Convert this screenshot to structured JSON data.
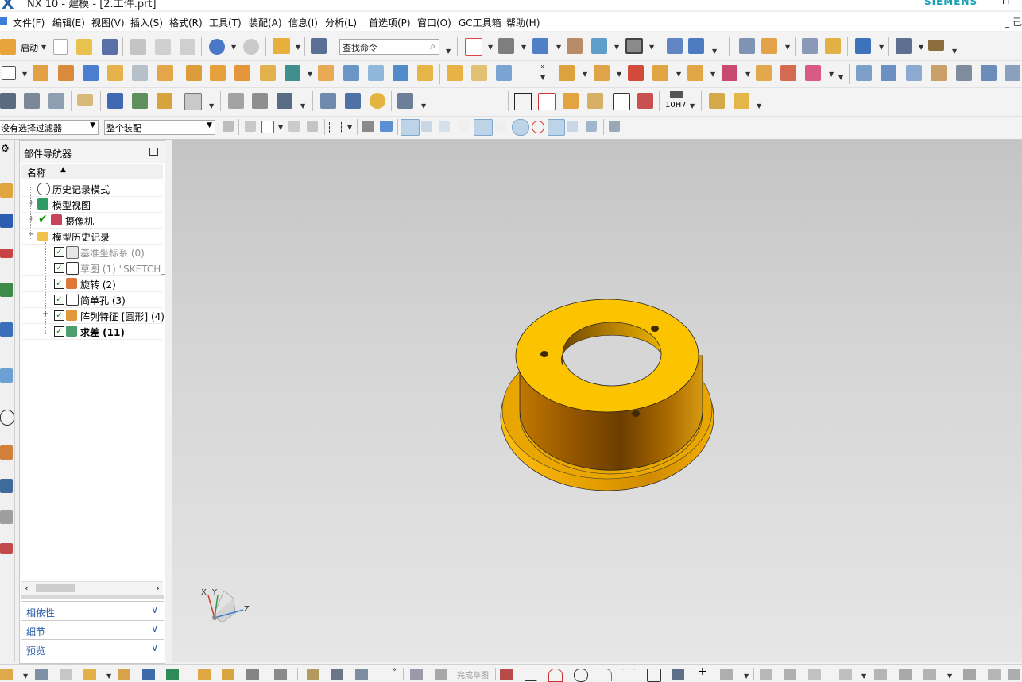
{
  "window": {
    "title": "NX 10 - 建模 - [2.工件.prt]",
    "brand": "SIEMENS",
    "controls": "_ ⊓"
  },
  "menu": {
    "items": [
      "文件(F)",
      "编辑(E)",
      "视图(V)",
      "插入(S)",
      "格式(R)",
      "工具(T)",
      "装配(A)",
      "信息(I)",
      "分析(L)",
      "首选项(P)",
      "窗口(O)",
      "GC工具箱",
      "帮助(H)"
    ],
    "right": "_ 己"
  },
  "toolbar": {
    "start_label": "启动",
    "search_placeholder": "查找命令",
    "selection_filter": "没有选择过滤器",
    "assembly_scope": "整个装配",
    "hole_tool_label": "10H7"
  },
  "navigator": {
    "title": "部件导航器",
    "column_name": "名称",
    "rows": [
      {
        "label": "历史记录模式",
        "icon": "clock-icon"
      },
      {
        "label": "模型视图",
        "icon": "model-views-icon"
      },
      {
        "label": "摄像机",
        "icon": "camera-icon"
      },
      {
        "label": "模型历史记录",
        "icon": "folder-icon"
      },
      {
        "label": "基准坐标系 (0)",
        "icon": "datum-csys-icon"
      },
      {
        "label": "草图 (1) \"SKETCH_",
        "icon": "sketch-icon"
      },
      {
        "label": "旋转 (2)",
        "icon": "revolve-icon"
      },
      {
        "label": "简单孔 (3)",
        "icon": "simple-hole-icon"
      },
      {
        "label": "阵列特征 [圆形] (4)",
        "icon": "pattern-feature-icon"
      },
      {
        "label": "求差 (11)",
        "icon": "subtract-icon"
      }
    ],
    "panels": [
      "相依性",
      "细节",
      "预览"
    ]
  },
  "viewport": {
    "part_color": "#f5c400",
    "triad": {
      "x": "X",
      "y": "Y",
      "z": "Z"
    }
  },
  "bottombar": {
    "finish_sketch": "完成草图"
  }
}
